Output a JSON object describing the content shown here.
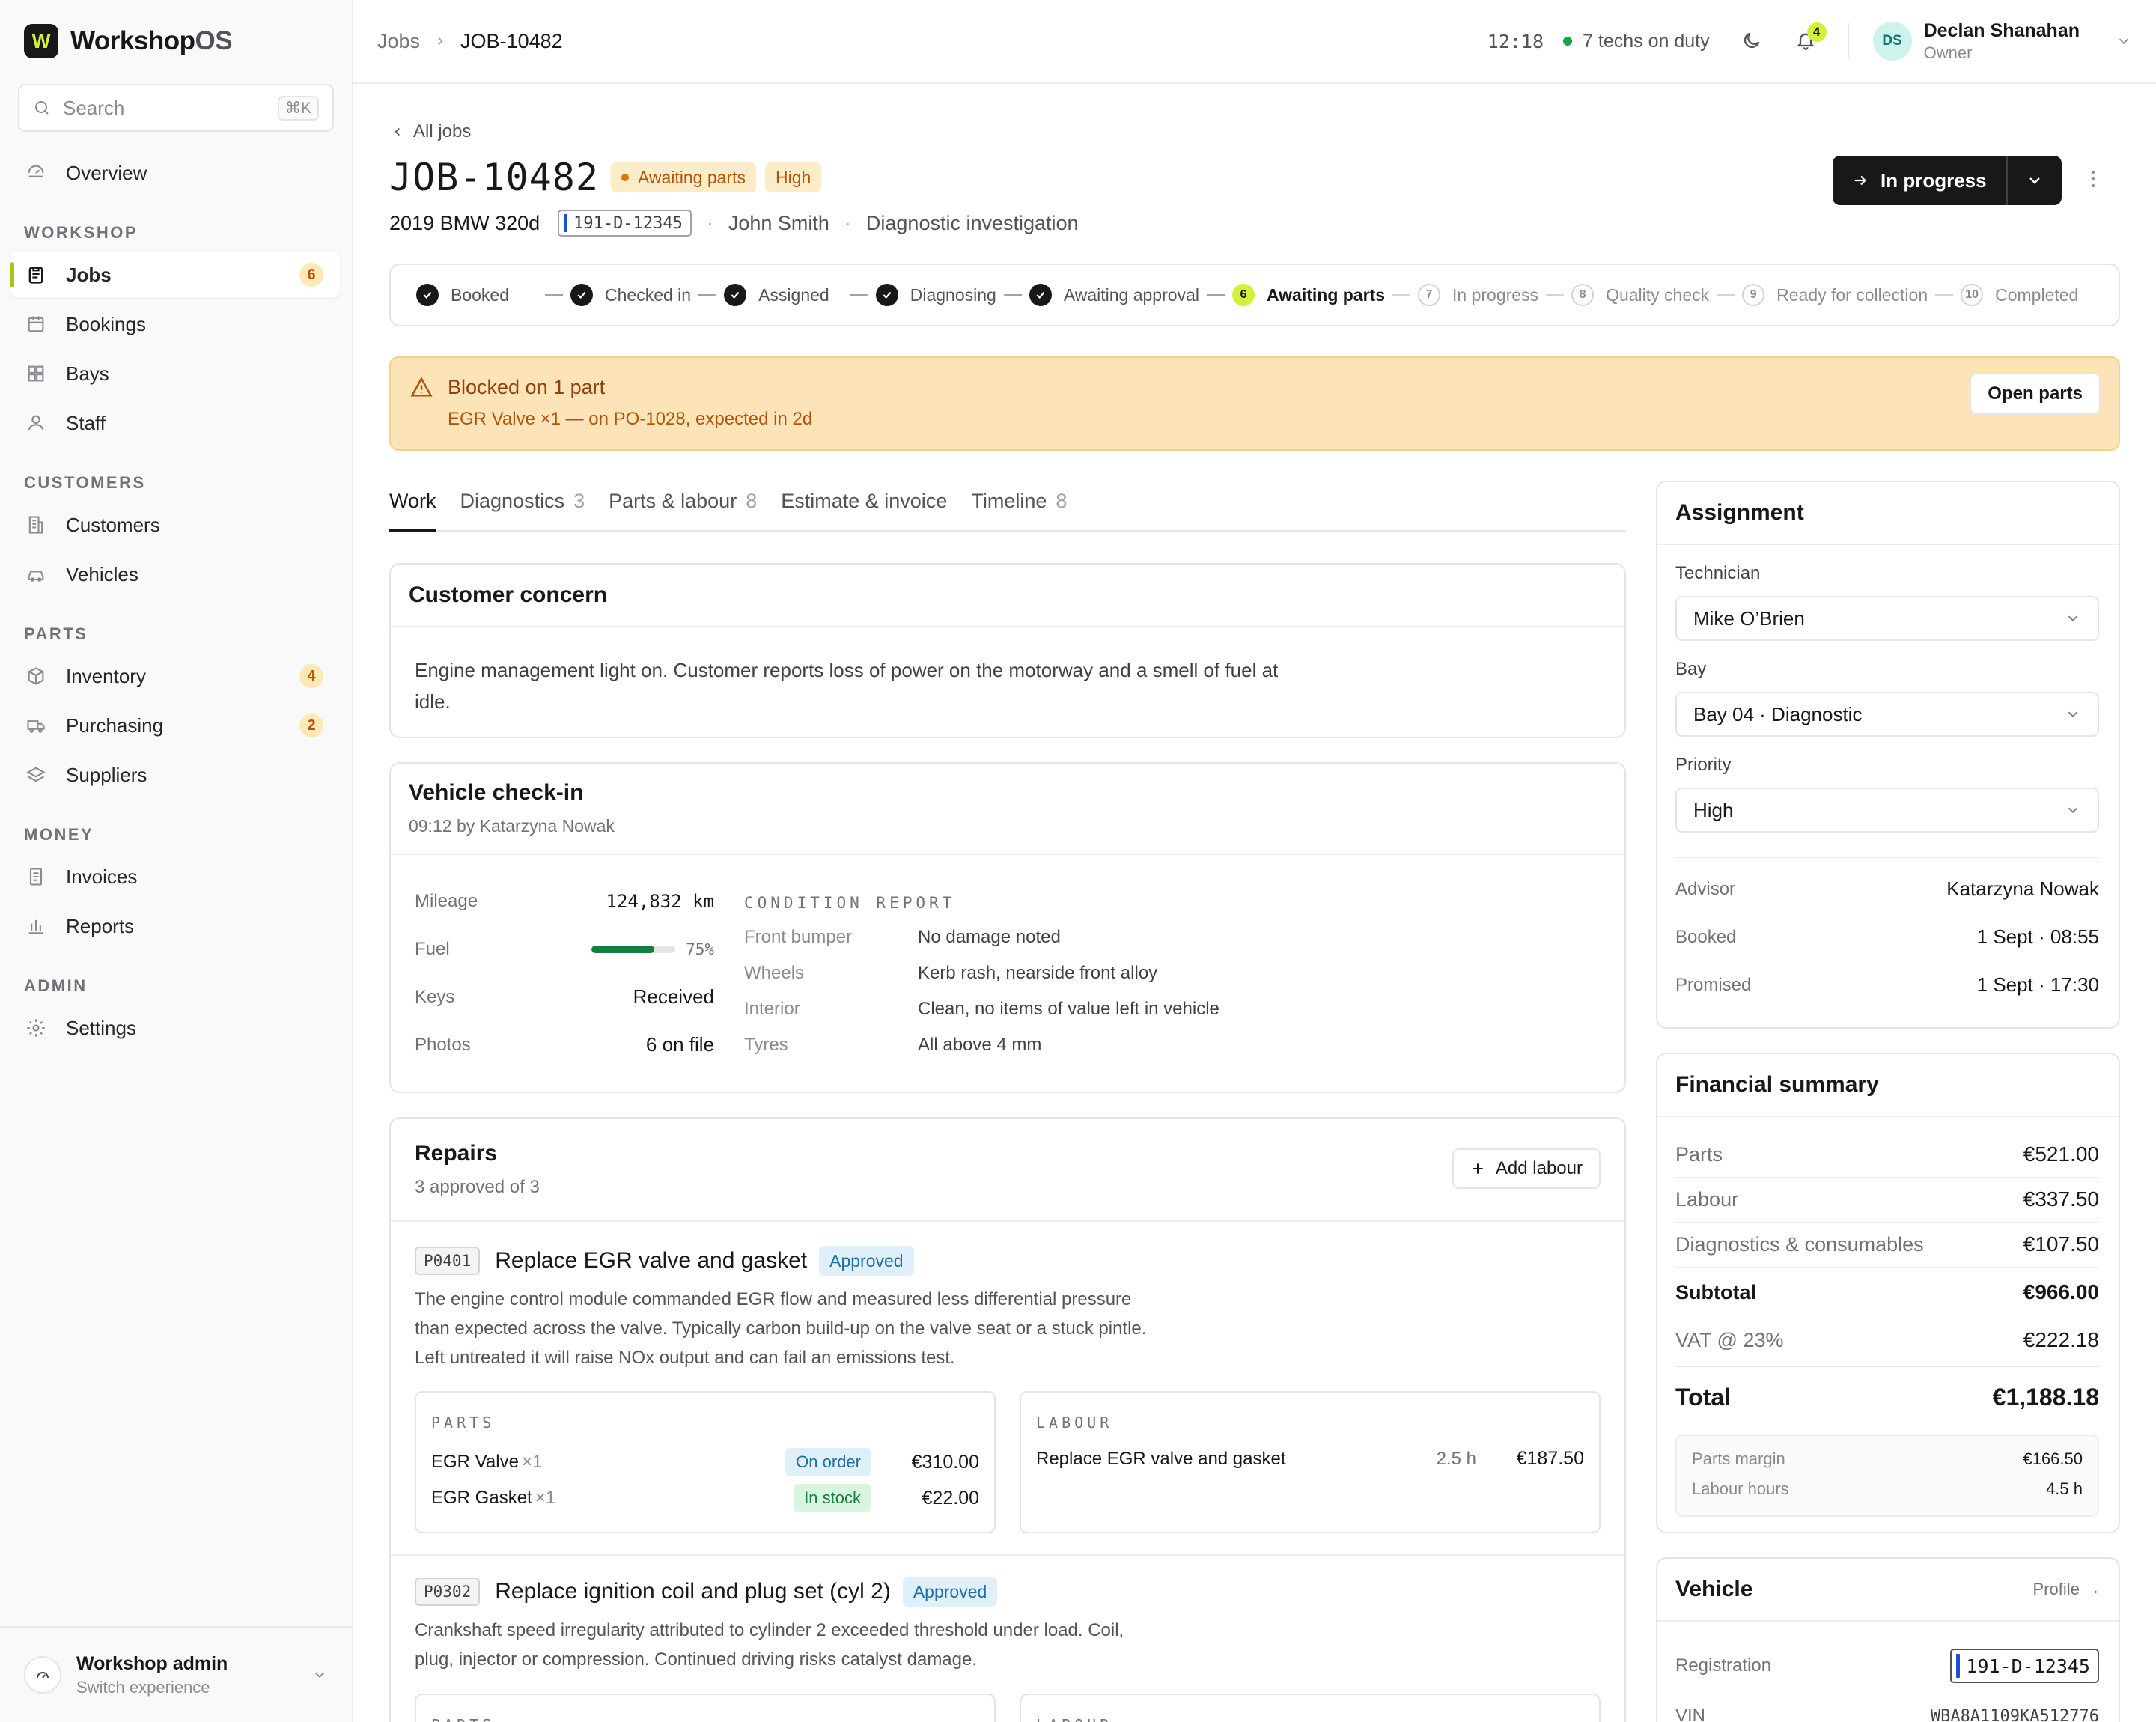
{
  "app": {
    "name_main": "Workshop",
    "name_suffix": "OS",
    "logo_letter": "W"
  },
  "search": {
    "placeholder": "Search",
    "shortcut": "⌘K"
  },
  "nav": {
    "overview": "Overview",
    "sections": {
      "workshop": "WORKSHOP",
      "customers": "CUSTOMERS",
      "parts": "PARTS",
      "money": "MONEY",
      "admin": "ADMIN"
    },
    "items": [
      {
        "label": "Jobs",
        "badge": "6"
      },
      {
        "label": "Bookings"
      },
      {
        "label": "Bays"
      },
      {
        "label": "Staff"
      },
      {
        "label": "Customers"
      },
      {
        "label": "Vehicles"
      },
      {
        "label": "Inventory",
        "badge": "4"
      },
      {
        "label": "Purchasing",
        "badge": "2"
      },
      {
        "label": "Suppliers"
      },
      {
        "label": "Invoices"
      },
      {
        "label": "Reports"
      },
      {
        "label": "Settings"
      }
    ]
  },
  "footer": {
    "title": "Workshop admin",
    "subtitle": "Switch experience"
  },
  "topbar": {
    "breadcrumb_root": "Jobs",
    "breadcrumb_current": "JOB-10482",
    "clock": "12:18",
    "on_duty": "7 techs on duty",
    "notifications": "4",
    "user_initials": "DS",
    "user_name": "Declan Shanahan",
    "user_role": "Owner"
  },
  "job": {
    "back_label": "All jobs",
    "id": "JOB-10482",
    "status_pill": "Awaiting parts",
    "priority_pill": "High",
    "vehicle": "2019 BMW 320d",
    "plate": "191-D-12345",
    "customer": "John Smith",
    "job_type": "Diagnostic investigation",
    "status_button": "In progress"
  },
  "stepper": [
    {
      "label": "Booked",
      "state": "done"
    },
    {
      "label": "Checked in",
      "state": "done"
    },
    {
      "label": "Assigned",
      "state": "done"
    },
    {
      "label": "Diagnosing",
      "state": "done"
    },
    {
      "label": "Awaiting approval",
      "state": "done"
    },
    {
      "label": "Awaiting parts",
      "state": "current",
      "num": "6"
    },
    {
      "label": "In progress",
      "state": "todo",
      "num": "7"
    },
    {
      "label": "Quality check",
      "state": "todo",
      "num": "8"
    },
    {
      "label": "Ready for collection",
      "state": "todo",
      "num": "9"
    },
    {
      "label": "Completed",
      "state": "todo",
      "num": "10"
    }
  ],
  "alert": {
    "title": "Blocked on 1 part",
    "detail": "EGR Valve ×1 — on PO-1028, expected in 2d",
    "action": "Open parts"
  },
  "tabs": [
    {
      "label": "Work",
      "count": ""
    },
    {
      "label": "Diagnostics",
      "count": "3"
    },
    {
      "label": "Parts & labour",
      "count": "8"
    },
    {
      "label": "Estimate & invoice",
      "count": ""
    },
    {
      "label": "Timeline",
      "count": "8"
    }
  ],
  "concern": {
    "title": "Customer concern",
    "text": "Engine management light on. Customer reports loss of power on the motorway and a smell of fuel at idle."
  },
  "checkin": {
    "title": "Vehicle check-in",
    "subtitle": "09:12 by Katarzyna Nowak",
    "mileage_label": "Mileage",
    "mileage": "124,832 km",
    "fuel_label": "Fuel",
    "fuel_pct": "75%",
    "fuel_level": 0.75,
    "keys_label": "Keys",
    "keys": "Received",
    "photos_label": "Photos",
    "photos": "6 on file",
    "condition_title": "CONDITION REPORT",
    "condition": [
      {
        "k": "Front bumper",
        "v": "No damage noted"
      },
      {
        "k": "Wheels",
        "v": "Kerb rash, nearside front alloy"
      },
      {
        "k": "Interior",
        "v": "Clean, no items of value left in vehicle"
      },
      {
        "k": "Tyres",
        "v": "All above 4 mm"
      }
    ]
  },
  "repairs": {
    "title": "Repairs",
    "subtitle": "3 approved of 3",
    "add_label": "Add labour",
    "parts_caption": "PARTS",
    "labour_caption": "LABOUR",
    "items": [
      {
        "code": "P0401",
        "title": "Replace EGR valve and gasket",
        "status": "Approved",
        "desc_lines": [
          "The engine control module commanded EGR flow and measured less differential pressure",
          "than expected across the valve. Typically carbon build-up on the valve seat or a stuck pintle.",
          "Left untreated it will raise NOx output and can fail an emissions test."
        ],
        "parts": [
          {
            "name": "EGR Valve",
            "qty": "×1",
            "stock": "On order",
            "amount": "€310.00"
          },
          {
            "name": "EGR Gasket",
            "qty": "×1",
            "stock": "In stock",
            "amount": "€22.00"
          }
        ],
        "labour": {
          "name": "Replace EGR valve and gasket",
          "hours": "2.5 h",
          "amount": "€187.50"
        }
      },
      {
        "code": "P0302",
        "title": "Replace ignition coil and plug set (cyl 2)",
        "status": "Approved",
        "desc_lines": [
          "Crankshaft speed irregularity attributed to cylinder 2 exceeded threshold under load. Coil,",
          "plug, injector or compression. Continued driving risks catalyst damage."
        ]
      }
    ]
  },
  "assignment": {
    "title": "Assignment",
    "technician_label": "Technician",
    "technician": "Mike O’Brien",
    "bay_label": "Bay",
    "bay": "Bay 04 · Diagnostic",
    "priority_label": "Priority",
    "priority": "High",
    "advisor_label": "Advisor",
    "advisor": "Katarzyna Nowak",
    "booked_label": "Booked",
    "booked": "1 Sept · 08:55",
    "promised_label": "Promised",
    "promised": "1 Sept · 17:30"
  },
  "financial": {
    "title": "Financial summary",
    "parts_label": "Parts",
    "parts": "€521.00",
    "labour_label": "Labour",
    "labour": "€337.50",
    "diag_label": "Diagnostics & consumables",
    "diag": "€107.50",
    "subtotal_label": "Subtotal",
    "subtotal": "€966.00",
    "vat_label": "VAT @ 23%",
    "vat": "€222.18",
    "total_label": "Total",
    "total": "€1,188.18",
    "margin_label": "Parts margin",
    "margin": "€166.50",
    "hours_label": "Labour hours",
    "hours": "4.5 h"
  },
  "vehicle_card": {
    "title": "Vehicle",
    "profile_link": "Profile →",
    "registration_label": "Registration",
    "registration": "191-D-12345",
    "vin_label": "VIN",
    "vin": "WBA8A1109KA512776"
  },
  "colors": {
    "accent": "#d4f13a",
    "amber_bg": "#fde4b8",
    "dark": "#18181b"
  }
}
